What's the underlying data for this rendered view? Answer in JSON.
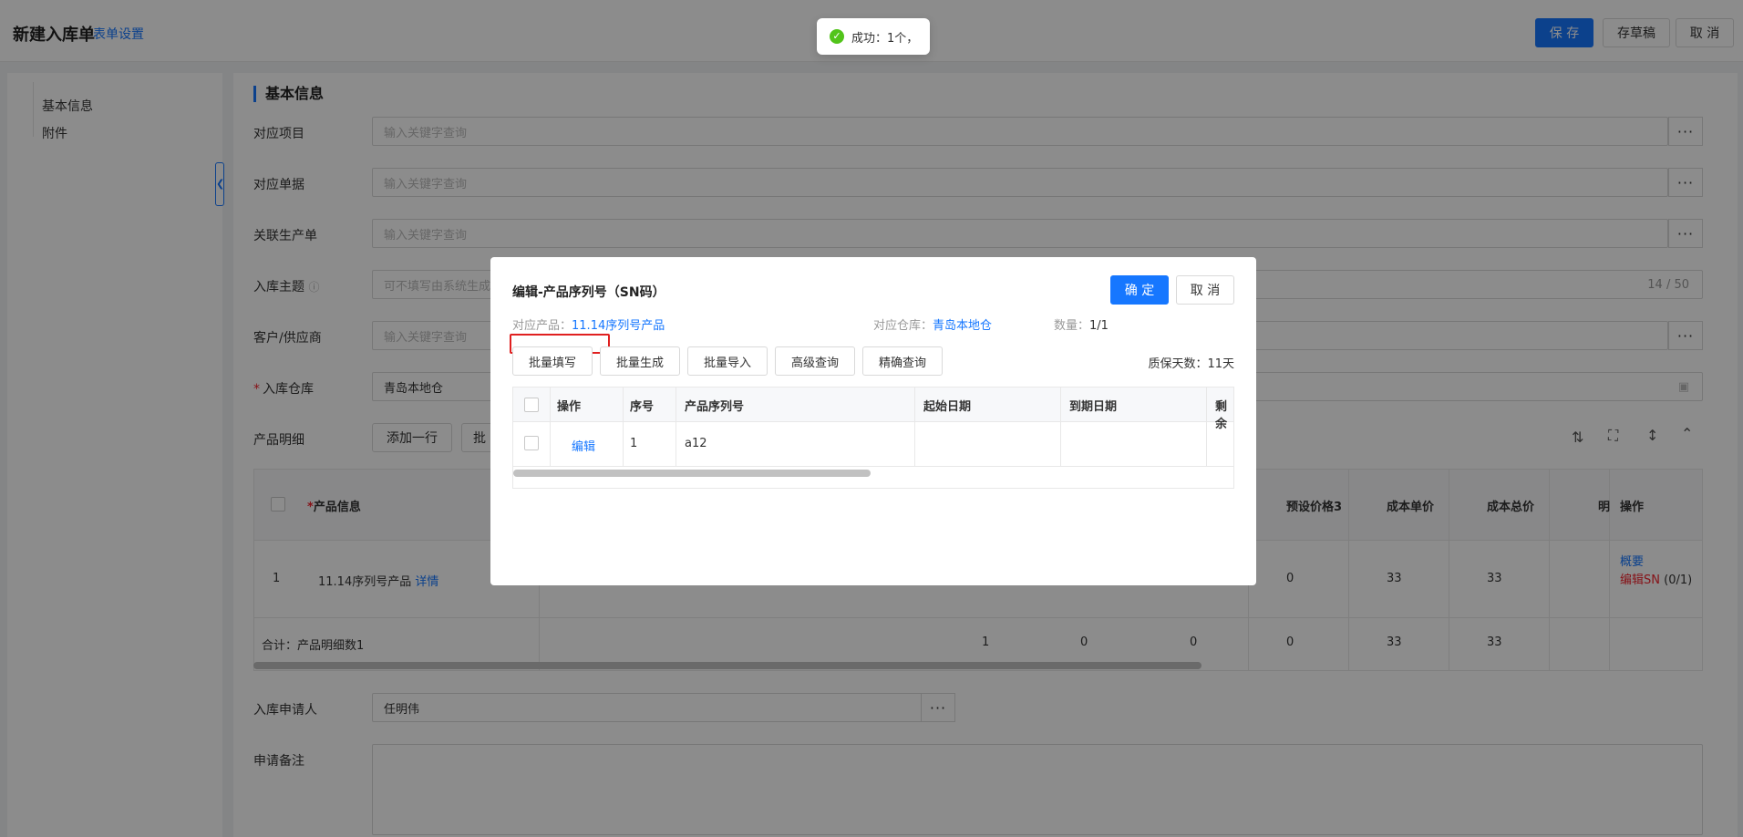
{
  "header": {
    "title": "新建入库单",
    "form_settings": "表单设置",
    "save": "保 存",
    "draft": "存草稿",
    "cancel": "取 消"
  },
  "toast": {
    "text": "成功：1个，"
  },
  "sidenav": {
    "items": [
      "基本信息",
      "附件"
    ]
  },
  "form": {
    "section_title": "基本信息",
    "fields": {
      "project": {
        "label": "对应项目",
        "placeholder": "输入关键字查询"
      },
      "document": {
        "label": "对应单据",
        "placeholder": "输入关键字查询"
      },
      "production": {
        "label": "关联生产单",
        "placeholder": "输入关键字查询"
      },
      "subject": {
        "label": "入库主题",
        "placeholder": "可不填写由系统生成",
        "counter": "14 / 50"
      },
      "customer": {
        "label": "客户/供应商",
        "placeholder": "输入关键字查询"
      },
      "warehouse": {
        "label": "入库仓库",
        "value": "青岛本地仓"
      },
      "products_label": "产品明细",
      "add_row": "添加一行",
      "batch": "批",
      "applicant": {
        "label": "入库申请人",
        "value": "任明伟"
      },
      "remarks": {
        "label": "申请备注"
      }
    }
  },
  "product_table": {
    "headers": [
      "产品信息",
      "预设价格3",
      "成本单价",
      "成本总价",
      "明",
      "操作"
    ],
    "row": {
      "index": "1",
      "product": "11.14序列号产品",
      "detail": "详情",
      "preset3": "0",
      "unit_cost": "33",
      "total_cost": "33",
      "op_summary": "概要",
      "op_edit_sn": "编辑SN",
      "op_count": "(0/1)"
    },
    "total": {
      "label": "合计：产品明细数1",
      "c1": "1",
      "c2": "0",
      "c3": "0",
      "preset3": "0",
      "unit_cost": "33",
      "total_cost": "33"
    }
  },
  "modal": {
    "title": "编辑-产品序列号（SN码）",
    "confirm": "确 定",
    "cancel": "取 消",
    "product_label": "对应产品：",
    "product_value": "11.14序列号产品",
    "warehouse_label": "对应仓库：",
    "warehouse_value": "青岛本地仓",
    "qty_label": "数量：",
    "qty_value": "1/1",
    "tools": [
      "批量填写",
      "批量生成",
      "批量导入",
      "高级查询",
      "精确查询"
    ],
    "warranty": "质保天数：11天",
    "columns": [
      "操作",
      "序号",
      "产品序列号",
      "起始日期",
      "到期日期",
      "剩余"
    ],
    "rows": [
      {
        "op": "编辑",
        "index": "1",
        "sn": "a12",
        "start": "",
        "end": "",
        "remain": ""
      }
    ]
  }
}
